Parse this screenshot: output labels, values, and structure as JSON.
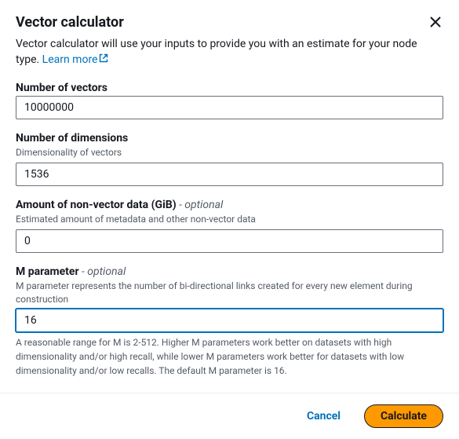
{
  "header": {
    "title": "Vector calculator"
  },
  "description": {
    "text": "Vector calculator will use your inputs to provide you with an estimate for your node type. ",
    "link_text": "Learn more"
  },
  "fields": {
    "num_vectors": {
      "label": "Number of vectors",
      "value": "10000000"
    },
    "num_dimensions": {
      "label": "Number of dimensions",
      "hint": "Dimensionality of vectors",
      "value": "1536"
    },
    "non_vector_data": {
      "label": "Amount of non-vector data (GiB)",
      "optional": " - optional",
      "hint": "Estimated amount of metadata and other non-vector data",
      "value": "0"
    },
    "m_parameter": {
      "label": "M parameter",
      "optional": " - optional",
      "hint": "M parameter represents the number of bi-directional links created for every new element during construction",
      "value": "16",
      "help": "A reasonable range for M is 2-512. Higher M parameters work better on datasets with high dimensionality and/or high recall, while lower M parameters work better for datasets with low dimensionality and/or low recalls. The default M parameter is 16."
    }
  },
  "footer": {
    "cancel": "Cancel",
    "calculate": "Calculate"
  }
}
